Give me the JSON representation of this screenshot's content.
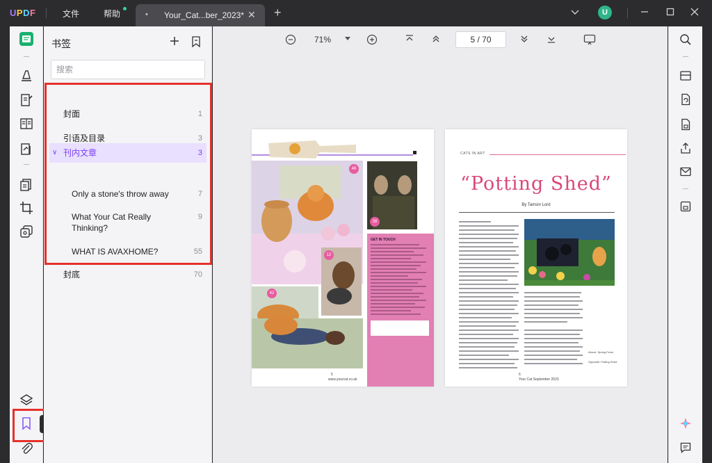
{
  "titlebar": {
    "logo": {
      "u": "U",
      "p": "P",
      "d": "D",
      "f": "F"
    },
    "menu_file": "文件",
    "menu_help": "帮助",
    "tab_marker": "•",
    "tab_title": "Your_Cat...ber_2023*",
    "tab_close": "✕",
    "new_tab": "+",
    "avatar_letter": "U"
  },
  "rail": {
    "tooltip": "书签",
    "icons": [
      "reader-icon",
      "highlighter-icon",
      "edit-icon",
      "page-layout-icon",
      "form-icon",
      "organize-pages-icon",
      "crop-icon",
      "layers-copy-icon",
      "layers-icon",
      "bookmark-icon",
      "attachment-icon"
    ]
  },
  "panel": {
    "title": "书签",
    "search_placeholder": "搜索",
    "items": [
      {
        "label": "封面",
        "page": "1"
      },
      {
        "label": "引语及目录",
        "page": "3"
      },
      {
        "label": "刊内文章",
        "page": "3",
        "expanded": true
      },
      {
        "label": "Only a stone's throw away",
        "page": "7"
      },
      {
        "label": "What Your Cat Really Thinking?",
        "page": "9"
      },
      {
        "label": "WHAT IS AVAXHOME?",
        "page": "55"
      },
      {
        "label": "封底",
        "page": "70"
      }
    ]
  },
  "toolbar": {
    "zoom": "71%",
    "current_page": "5",
    "page_sep": "/",
    "total_pages": "70"
  },
  "colors": {
    "accent": "#7a3ff2",
    "highlight_box": "#e6302a",
    "magazine_pink": "#d94877"
  },
  "document": {
    "left_page": {
      "badges": [
        "46",
        "38",
        "12",
        "42"
      ],
      "contact_heading": "GET IN TOUCH",
      "page_number": "5",
      "footer": "www.yourcat.co.uk"
    },
    "right_page": {
      "kicker": "CATS IN ART",
      "title": "“Potting Shed”",
      "byline": "By Tamsin Lord",
      "caption": "Above: Spring Fever",
      "caption2": "Opposite: Potting Shed",
      "page_number": "6",
      "footer": "Your Cat September 2023"
    }
  }
}
